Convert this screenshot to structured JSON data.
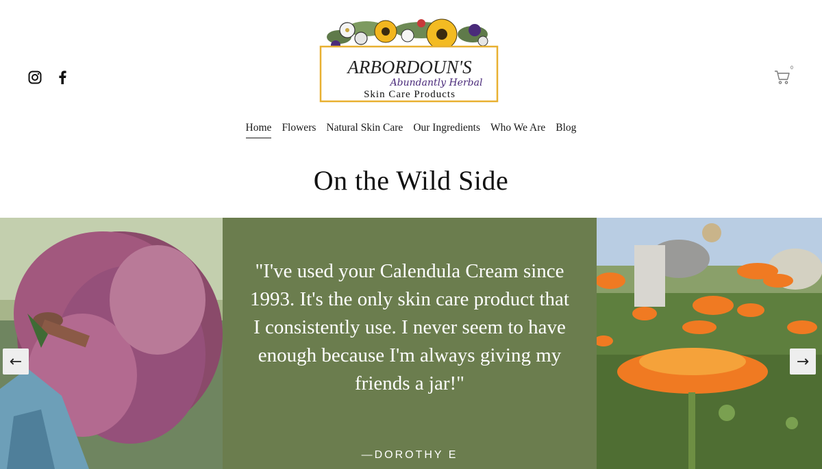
{
  "logo": {
    "line1": "ARBORDOUN'S",
    "line2": "Abundantly Herbal",
    "line3": "Skin Care Products"
  },
  "social": {
    "instagram_icon": "instagram-icon",
    "facebook_icon": "facebook-icon"
  },
  "cart": {
    "icon": "cart-icon",
    "count": "0"
  },
  "nav": {
    "items": [
      {
        "label": "Home",
        "active": true
      },
      {
        "label": "Flowers"
      },
      {
        "label": "Natural Skin Care"
      },
      {
        "label": "Our Ingredients"
      },
      {
        "label": "Who We Are"
      },
      {
        "label": "Blog"
      }
    ]
  },
  "page": {
    "title": "On the Wild Side"
  },
  "testimonial": {
    "quote": "\"I've used your Calendula Cream since 1993. It's the only skin care product that I consistently use. I never seem to have enough because I'm always giving my friends a jar!\"",
    "author": "—DOROTHY E"
  },
  "gallery": {
    "prev_label": "←",
    "next_label": "→"
  },
  "colors": {
    "testimonial_bg": "#6b7d4e",
    "logo_border": "#e8b030",
    "logo_script": "#4a2a7a"
  }
}
